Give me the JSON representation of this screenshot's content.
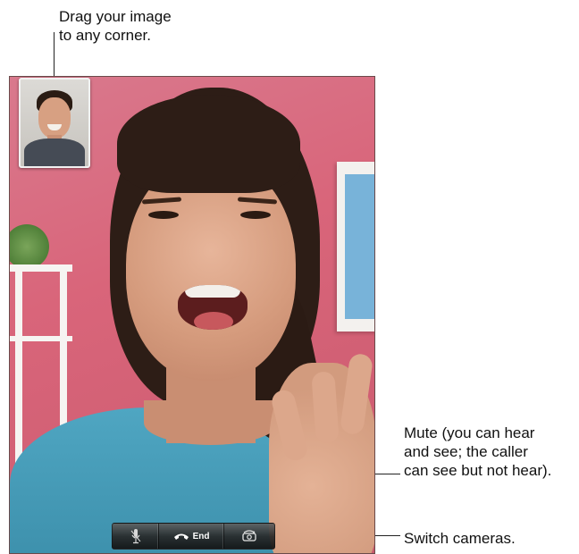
{
  "callouts": {
    "drag": "Drag your image\nto any corner.",
    "mute": "Mute (you can hear\nand see; the caller\ncan see but not hear).",
    "switch": "Switch cameras."
  },
  "controls": {
    "mute_icon": "microphone-icon",
    "end_icon": "phone-handset-icon",
    "end_label": "End",
    "switch_icon": "switch-camera-icon"
  },
  "colors": {
    "wall": "#d9657a",
    "shirt": "#3c8fab",
    "control_bar": "#2a2a2a"
  }
}
